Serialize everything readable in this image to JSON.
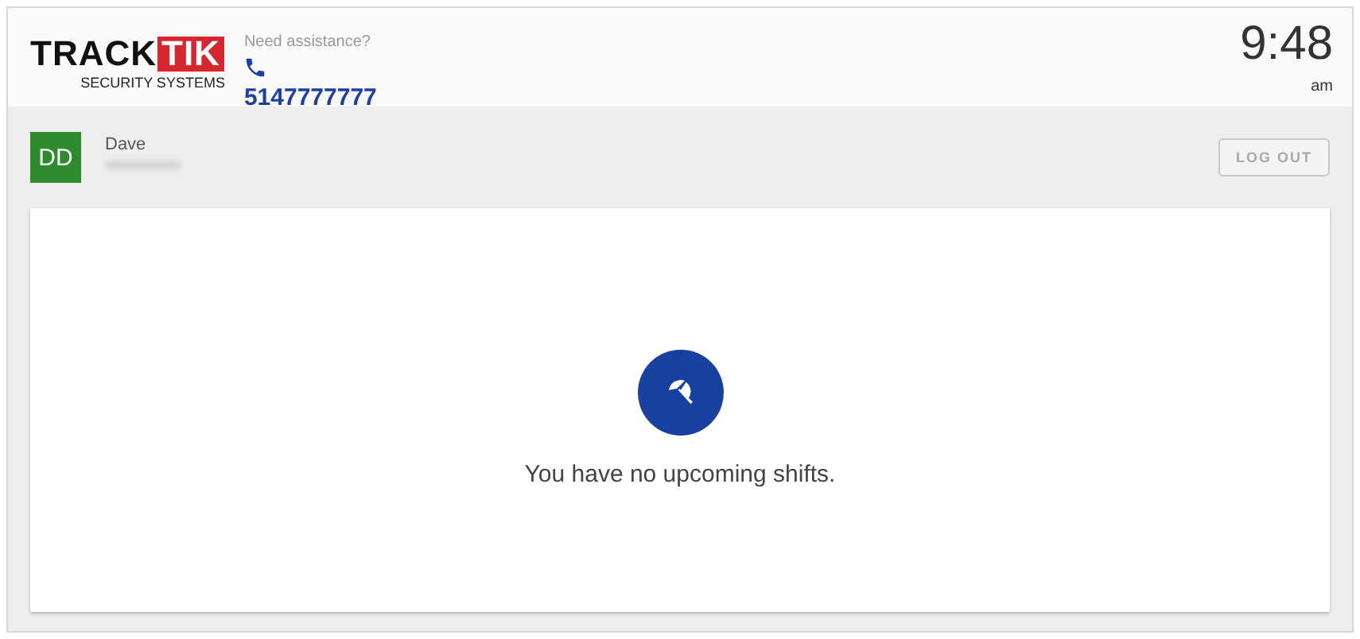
{
  "logo": {
    "word": "TRACK",
    "highlight": "TIK",
    "tagline": "SECURITY SYSTEMS"
  },
  "assistance": {
    "label": "Need assistance?",
    "phone": "5147777777"
  },
  "clock": {
    "time": "9:48",
    "period": "am"
  },
  "user": {
    "initials": "DD",
    "name": "Dave"
  },
  "logout": "LOG OUT",
  "empty_state": {
    "message": "You have no upcoming shifts."
  }
}
